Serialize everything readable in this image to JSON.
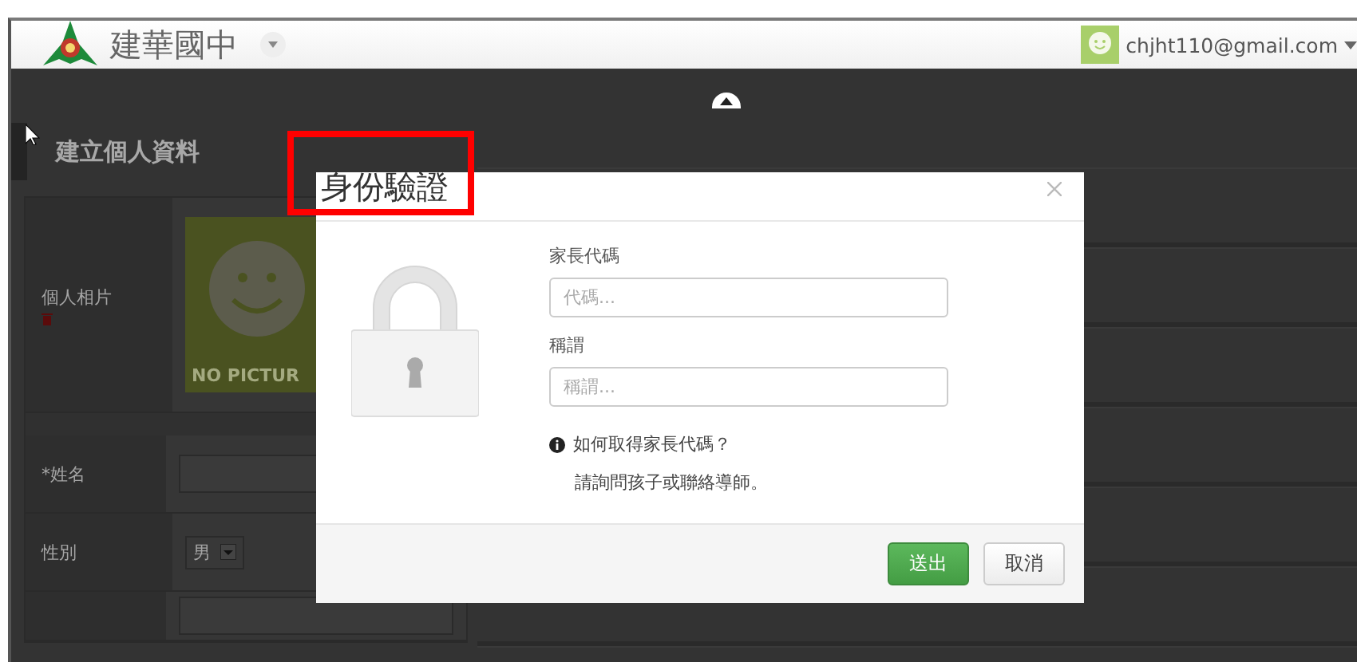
{
  "header": {
    "school_name": "建華國中",
    "user_email": "chjht110@gmail.com"
  },
  "page": {
    "section_title": "建立個人資料",
    "photo_label": "個人相片",
    "photo_placeholder": "NO PICTUR",
    "fields": [
      {
        "label": "*姓名",
        "kind": "text"
      },
      {
        "label": "性別",
        "kind": "select",
        "value": "男"
      }
    ]
  },
  "dialog": {
    "title": "身份驗證",
    "fields": [
      {
        "label": "家長代碼",
        "placeholder": "代碼..."
      },
      {
        "label": "稱謂",
        "placeholder": "稱謂..."
      }
    ],
    "help_title": "如何取得家長代碼？",
    "help_text": "請詢問孩子或聯絡導師。",
    "buttons": [
      {
        "label": "送出",
        "kind": "primary"
      },
      {
        "label": "取消",
        "kind": "default"
      }
    ]
  }
}
